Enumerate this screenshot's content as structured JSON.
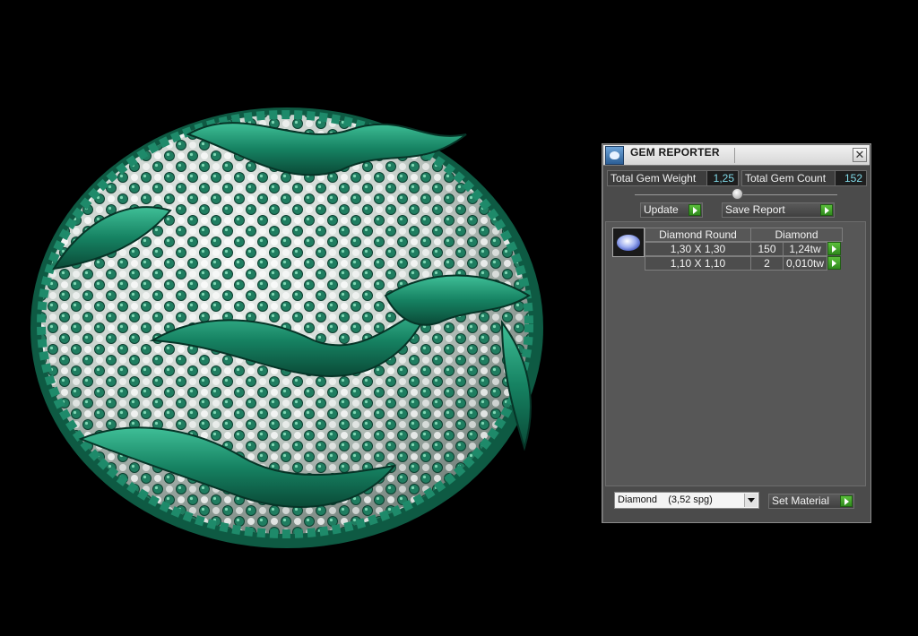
{
  "panel": {
    "title": "GEM REPORTER",
    "close_label": "✕",
    "total_weight_label": "Total Gem Weight",
    "total_weight_value": "1,25",
    "total_count_label": "Total Gem Count",
    "total_count_value": "152",
    "update_label": "Update",
    "save_report_label": "Save Report",
    "table": {
      "headers": [
        "Diamond Round",
        "Diamond"
      ],
      "rows": [
        {
          "size": "1,30 X 1,30",
          "count": "150",
          "weight": "1,24tw"
        },
        {
          "size": "1,10 X 1,10",
          "count": "2",
          "weight": "0,010tw"
        }
      ]
    },
    "material_selected": "Diamond    (3,52 spg)",
    "set_material_label": "Set Material"
  },
  "colors": {
    "viewport_bg": "#000000",
    "model_green": "#1e8a6a",
    "panel_bg": "#4b4b4b",
    "value_text": "#7fd8e6",
    "action_green": "#3aa02a"
  },
  "icons": [
    "gem-reporter-icon",
    "close-icon",
    "play-icon",
    "gem-thumbnail",
    "dropdown-arrow-icon"
  ]
}
